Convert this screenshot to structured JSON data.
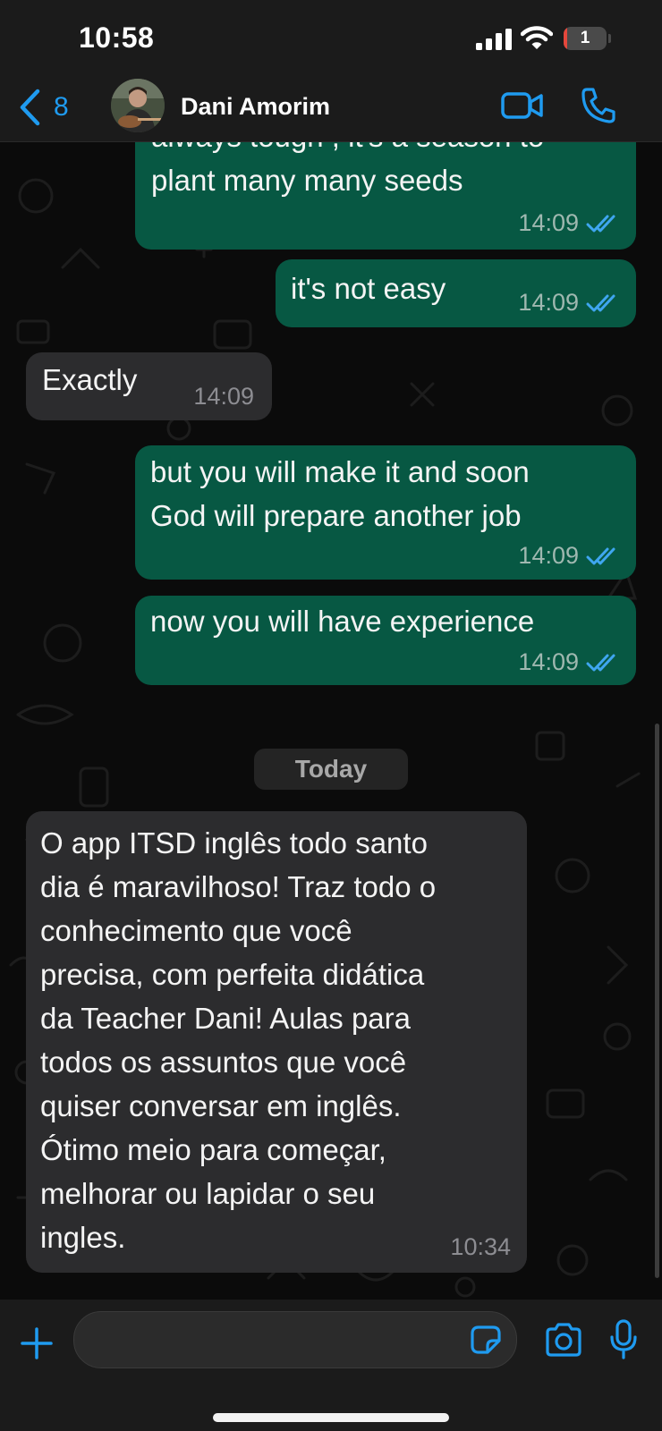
{
  "status_bar": {
    "time": "10:58",
    "battery_level": "1",
    "battery_fraction": 0.02,
    "icons": [
      "signal-icon",
      "wifi-icon",
      "battery-icon"
    ]
  },
  "header": {
    "back_count": "8",
    "contact_name": "Dani Amorim",
    "icons": [
      "chevron-left-icon",
      "video-camera-icon",
      "phone-icon"
    ]
  },
  "messages": [
    {
      "direction": "outgoing",
      "text": "always tough , it's a season to\nplant many many seeds",
      "time": "14:09",
      "status": "read"
    },
    {
      "direction": "outgoing",
      "text": "it's not easy",
      "time": "14:09",
      "status": "read"
    },
    {
      "direction": "incoming",
      "text": "Exactly",
      "time": "14:09"
    },
    {
      "direction": "outgoing",
      "text": "but you will make it and soon\nGod will prepare another job",
      "time": "14:09",
      "status": "read"
    },
    {
      "direction": "outgoing",
      "text": "now you will have experience",
      "time": "14:09",
      "status": "read"
    },
    {
      "direction": "incoming",
      "text": "O app ITSD inglês todo santo\ndia é maravilhoso! Traz todo o\nconhecimento que você\nprecisa, com perfeita didática\nda Teacher Dani! Aulas para\ntodos os assuntos que você\nquiser conversar em inglês.\nÓtimo meio para começar,\nmelhorar ou lapidar o seu\ningles.",
      "time": "10:34"
    }
  ],
  "date_separator": "Today",
  "input_bar": {
    "placeholder": "",
    "icons": [
      "plus-icon",
      "sticker-icon",
      "camera-icon",
      "microphone-icon"
    ]
  },
  "colors": {
    "accent": "#1f9bf0",
    "outgoing_bubble": "#075843",
    "incoming_bubble": "#2c2c2e",
    "read_ticks": "#3fa6f0",
    "background": "#0b0b0b",
    "bar": "#1b1b1b",
    "battery_low": "#e5473c"
  }
}
